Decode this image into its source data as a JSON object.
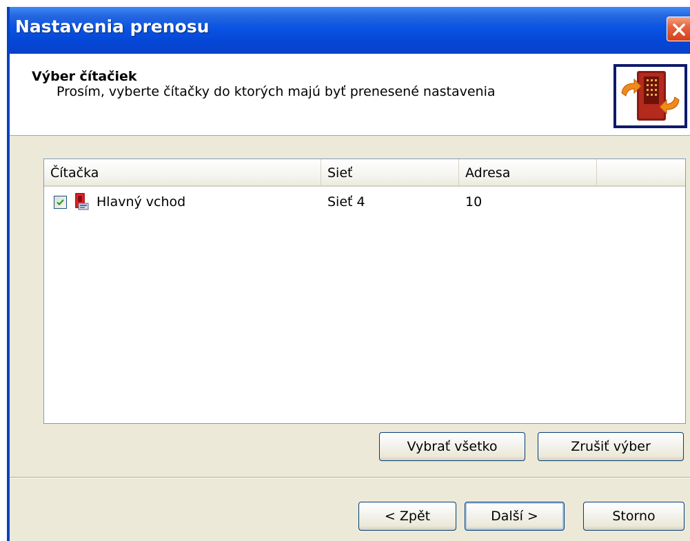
{
  "window": {
    "title": "Nastavenia prenosu"
  },
  "header": {
    "title": "Výber čítačiek",
    "subtitle": "Prosím, vyberte čítačky do ktorých majú byť prenesené nastavenia",
    "image_icon": "reader-transfer-icon"
  },
  "list": {
    "columns": [
      "Čítačka",
      "Sieť",
      "Adresa",
      ""
    ],
    "rows": [
      {
        "checked": true,
        "icon": "reader-icon",
        "reader": "Hlavný vchod",
        "network": "Sieť 4",
        "address": "10"
      }
    ]
  },
  "buttons": {
    "select_all": "Vybrať všetko",
    "deselect": "Zrušiť výber",
    "back": "< Zpět",
    "next": "Další >",
    "cancel": "Storno"
  },
  "colors": {
    "title_bar": "#0a54e3",
    "dialog_bg": "#ece9d8",
    "close_button": "#d5411a",
    "button_border": "#003c74"
  }
}
